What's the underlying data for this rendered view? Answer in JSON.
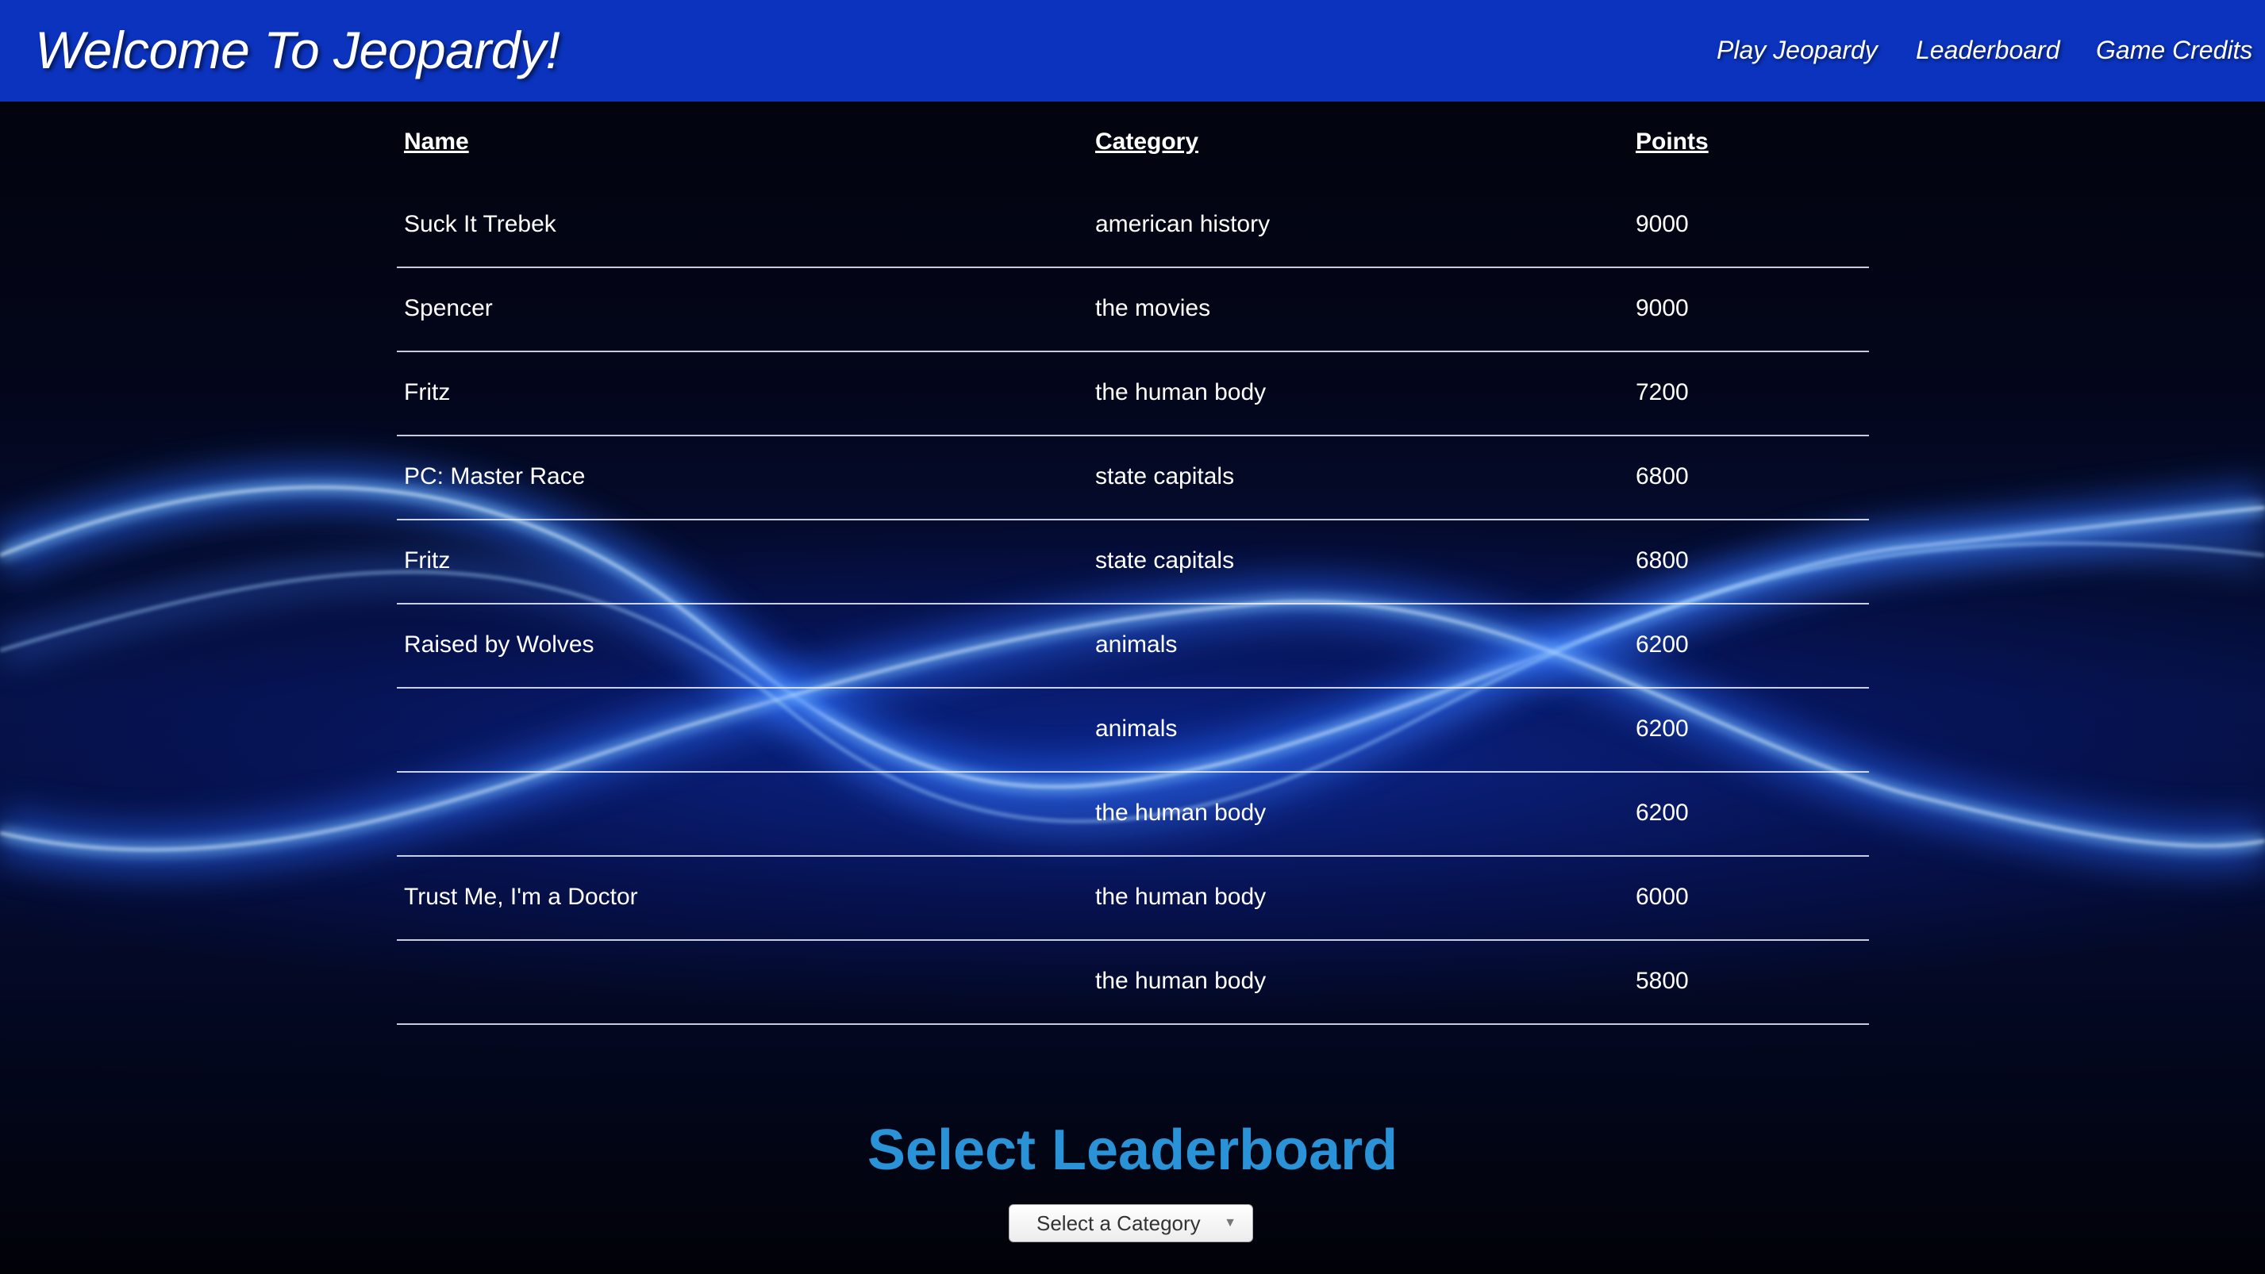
{
  "header": {
    "title": "Welcome To Jeopardy!",
    "nav": {
      "play": "Play Jeopardy",
      "leaderboard": "Leaderboard",
      "credits": "Game Credits"
    }
  },
  "leaderboard": {
    "columns": {
      "name": "Name",
      "category": "Category",
      "points": "Points"
    },
    "rows": [
      {
        "name": "Suck It Trebek",
        "category": "american history",
        "points": "9000"
      },
      {
        "name": "Spencer",
        "category": "the movies",
        "points": "9000"
      },
      {
        "name": "Fritz",
        "category": "the human body",
        "points": "7200"
      },
      {
        "name": "PC: Master Race",
        "category": "state capitals",
        "points": "6800"
      },
      {
        "name": "Fritz",
        "category": "state capitals",
        "points": "6800"
      },
      {
        "name": "Raised by Wolves",
        "category": "animals",
        "points": "6200"
      },
      {
        "name": "",
        "category": "animals",
        "points": "6200"
      },
      {
        "name": "",
        "category": "the human body",
        "points": "6200"
      },
      {
        "name": "Trust Me, I'm a Doctor",
        "category": "the human body",
        "points": "6000"
      },
      {
        "name": "",
        "category": "the human body",
        "points": "5800"
      }
    ]
  },
  "selector": {
    "title": "Select Leaderboard",
    "selected": "Select a Category",
    "caret_icon": "chevron-down-icon"
  },
  "colors": {
    "navbar": "#0b33bd",
    "title_accent": "#2a93d8",
    "background": "#000000"
  }
}
